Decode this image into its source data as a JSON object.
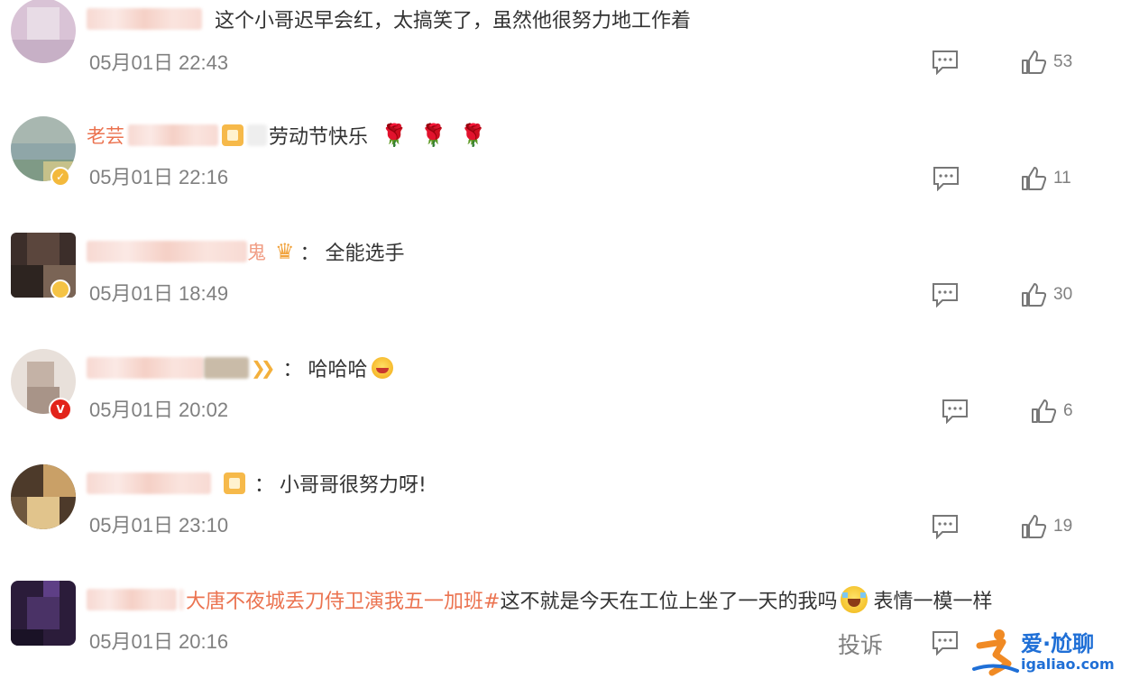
{
  "comments": [
    {
      "username": "",
      "text": "这个小哥迟早会红，太搞笑了，虽然他很努力地工作着",
      "time": "05月01日 22:43",
      "likes": "53",
      "avatar_colors": [
        "#d9c3d6",
        "#c7b0c6",
        "#e8dce6",
        "#bfa6bd"
      ],
      "badge": null
    },
    {
      "username": "老芸",
      "text": "劳动节快乐",
      "reactions": [
        "🌹",
        "🌹",
        "🌹"
      ],
      "time": "05月01日 22:16",
      "likes": "11",
      "avatar_colors": [
        "#8fa6a8",
        "#7f9a86",
        "#a8b7b0",
        "#c6c18a"
      ],
      "badge": "yellow-check"
    },
    {
      "username": "",
      "username_tail": "鬼",
      "text": "全能选手",
      "time": "05月01日 18:49",
      "likes": "30",
      "avatar_colors": [
        "#3c2e2a",
        "#5b463d",
        "#2d2420",
        "#7a6455"
      ],
      "badge": "yellow"
    },
    {
      "username": "",
      "text": "哈哈哈",
      "time": "05月01日 20:02",
      "likes": "6",
      "avatar_colors": [
        "#d8cfc8",
        "#c4b2a6",
        "#e8e0da",
        "#a89488"
      ],
      "badge": "red-v"
    },
    {
      "username": "",
      "text": "小哥哥很努力呀!",
      "time": "05月01日 23:10",
      "likes": "19",
      "avatar_colors": [
        "#4d3a2a",
        "#c9a067",
        "#6e573e",
        "#e1c48c"
      ],
      "badge": null
    },
    {
      "username": "",
      "hashtag": "大唐不夜城丢刀侍卫演我五一加班#",
      "text": "这不就是今天在工位上坐了一天的我吗",
      "text_after": "表情一模一样",
      "time": "05月01日 20:16",
      "likes": "",
      "avatar_colors": [
        "#2b1c3a",
        "#4a3266",
        "#1a1226",
        "#5e3f86"
      ],
      "badge": null
    }
  ],
  "report_label": "投诉",
  "watermark": {
    "title": "爱·尬聊",
    "url": "igaliao.com"
  },
  "colors": {
    "link_orange": "#eb7350",
    "meta_gray": "#808080",
    "text": "#333333"
  }
}
